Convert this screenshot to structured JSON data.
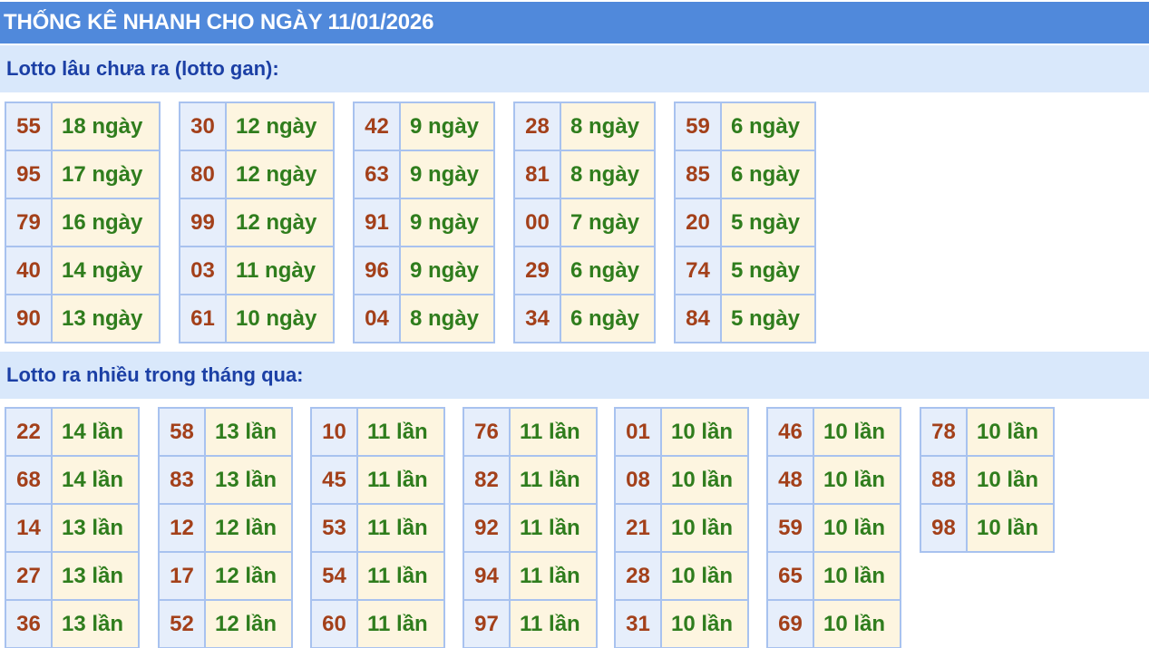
{
  "header": {
    "title": "THỐNG KÊ NHANH CHO NGÀY 11/01/2026"
  },
  "gan": {
    "title": "Lotto lâu chưa ra (lotto gan):",
    "groups": [
      [
        {
          "num": "55",
          "val": "18 ngày"
        },
        {
          "num": "95",
          "val": "17 ngày"
        },
        {
          "num": "79",
          "val": "16 ngày"
        },
        {
          "num": "40",
          "val": "14 ngày"
        },
        {
          "num": "90",
          "val": "13 ngày"
        }
      ],
      [
        {
          "num": "30",
          "val": "12 ngày"
        },
        {
          "num": "80",
          "val": "12 ngày"
        },
        {
          "num": "99",
          "val": "12 ngày"
        },
        {
          "num": "03",
          "val": "11 ngày"
        },
        {
          "num": "61",
          "val": "10 ngày"
        }
      ],
      [
        {
          "num": "42",
          "val": "9 ngày"
        },
        {
          "num": "63",
          "val": "9 ngày"
        },
        {
          "num": "91",
          "val": "9 ngày"
        },
        {
          "num": "96",
          "val": "9 ngày"
        },
        {
          "num": "04",
          "val": "8 ngày"
        }
      ],
      [
        {
          "num": "28",
          "val": "8 ngày"
        },
        {
          "num": "81",
          "val": "8 ngày"
        },
        {
          "num": "00",
          "val": "7 ngày"
        },
        {
          "num": "29",
          "val": "6 ngày"
        },
        {
          "num": "34",
          "val": "6 ngày"
        }
      ],
      [
        {
          "num": "59",
          "val": "6 ngày"
        },
        {
          "num": "85",
          "val": "6 ngày"
        },
        {
          "num": "20",
          "val": "5 ngày"
        },
        {
          "num": "74",
          "val": "5 ngày"
        },
        {
          "num": "84",
          "val": "5 ngày"
        }
      ]
    ]
  },
  "nhieu": {
    "title": "Lotto ra nhiều trong tháng qua:",
    "groups": [
      [
        {
          "num": "22",
          "val": "14 lần"
        },
        {
          "num": "68",
          "val": "14 lần"
        },
        {
          "num": "14",
          "val": "13 lần"
        },
        {
          "num": "27",
          "val": "13 lần"
        },
        {
          "num": "36",
          "val": "13 lần"
        }
      ],
      [
        {
          "num": "58",
          "val": "13 lần"
        },
        {
          "num": "83",
          "val": "13 lần"
        },
        {
          "num": "12",
          "val": "12 lần"
        },
        {
          "num": "17",
          "val": "12 lần"
        },
        {
          "num": "52",
          "val": "12 lần"
        }
      ],
      [
        {
          "num": "10",
          "val": "11 lần"
        },
        {
          "num": "45",
          "val": "11 lần"
        },
        {
          "num": "53",
          "val": "11 lần"
        },
        {
          "num": "54",
          "val": "11 lần"
        },
        {
          "num": "60",
          "val": "11 lần"
        }
      ],
      [
        {
          "num": "76",
          "val": "11 lần"
        },
        {
          "num": "82",
          "val": "11 lần"
        },
        {
          "num": "92",
          "val": "11 lần"
        },
        {
          "num": "94",
          "val": "11 lần"
        },
        {
          "num": "97",
          "val": "11 lần"
        }
      ],
      [
        {
          "num": "01",
          "val": "10 lần"
        },
        {
          "num": "08",
          "val": "10 lần"
        },
        {
          "num": "21",
          "val": "10 lần"
        },
        {
          "num": "28",
          "val": "10 lần"
        },
        {
          "num": "31",
          "val": "10 lần"
        }
      ],
      [
        {
          "num": "46",
          "val": "10 lần"
        },
        {
          "num": "48",
          "val": "10 lần"
        },
        {
          "num": "59",
          "val": "10 lần"
        },
        {
          "num": "65",
          "val": "10 lần"
        },
        {
          "num": "69",
          "val": "10 lần"
        }
      ],
      [
        {
          "num": "78",
          "val": "10 lần"
        },
        {
          "num": "88",
          "val": "10 lần"
        },
        {
          "num": "98",
          "val": "10 lần"
        }
      ]
    ]
  }
}
